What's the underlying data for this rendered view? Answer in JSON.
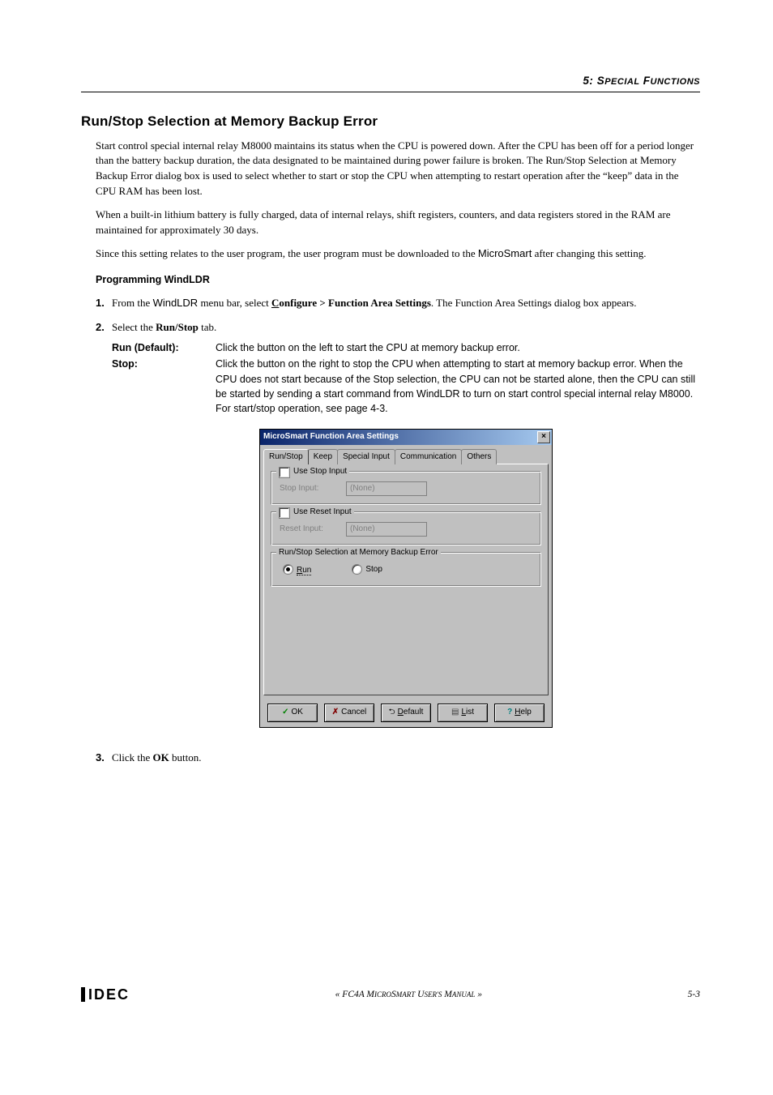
{
  "header": {
    "chapter": "5: Special Functions"
  },
  "section": {
    "title": "Run/Stop Selection at Memory Backup Error",
    "p1": "Start control special internal relay M8000 maintains its status when the CPU is powered down. After the CPU has been off for a period longer than the battery backup duration, the data designated to be maintained during power failure is broken. The Run/Stop Selection at Memory Backup Error dialog box is used to select whether to start or stop the CPU when attempting to restart operation after the “keep” data in the CPU RAM has been lost.",
    "p2": "When a built-in lithium battery is fully charged, data of internal relays, shift registers, counters, and data registers stored in the RAM are maintained for approximately 30 days.",
    "p3_a": "Since this setting relates to the user program, the user program must be downloaded to the ",
    "p3_b": "MicroSmart",
    "p3_c": " after changing this setting."
  },
  "prog": {
    "heading": "Programming WindLDR",
    "step1_num": "1.",
    "step1_a": "From the ",
    "step1_b": "WindLDR",
    "step1_c": " menu bar, select ",
    "step1_d": "C",
    "step1_e": "onfigure > Function Area Settings",
    "step1_f": ". The Function Area Settings dialog box appears.",
    "step2_num": "2.",
    "step2_a": "Select the ",
    "step2_b": "Run/Stop",
    "step2_c": " tab.",
    "step3_num": "3.",
    "step3_a": "Click the ",
    "step3_b": "OK",
    "step3_c": " button."
  },
  "desc": {
    "run_label": "Run (Default):",
    "run_text": "Click the button on the left to start the CPU at memory backup error.",
    "stop_label": "Stop:",
    "stop_text": "Click the button on the right to stop the CPU when attempting to start at memory backup error. When the CPU does not start because of the Stop selection, the CPU can not be started alone, then the CPU can still be started by sending a start command from WindLDR to turn on start control special internal relay M8000. For start/stop operation, see page 4-3."
  },
  "dialog": {
    "title": "MicroSmart Function Area Settings",
    "tabs": [
      "Run/Stop",
      "Keep",
      "Special Input",
      "Communication",
      "Others"
    ],
    "use_stop": "Use Stop Input",
    "stop_label": "Stop Input:",
    "none1": "(None)",
    "use_reset": "Use Reset Input",
    "reset_label": "Reset Input:",
    "none2": "(None)",
    "group3": "Run/Stop Selection at Memory Backup Error",
    "run": "Run",
    "stop": "Stop",
    "ok": "OK",
    "cancel": "Cancel",
    "default": "Default",
    "list": "List",
    "help": "Help"
  },
  "footer": {
    "logo": "IDEC",
    "center": "« FC4A MicroSmart User's Manual »",
    "page": "5-3"
  }
}
